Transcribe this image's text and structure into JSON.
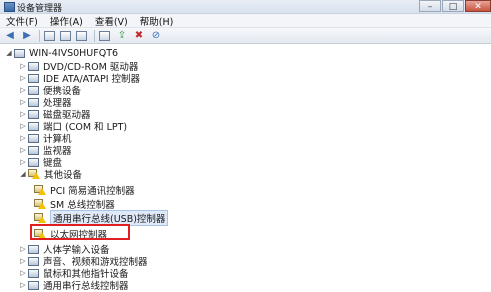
{
  "window": {
    "title": "设备管理器",
    "controls": [
      "–",
      "□",
      "✕"
    ]
  },
  "menu": [
    "文件(F)",
    "操作(A)",
    "查看(V)",
    "帮助(H)"
  ],
  "toolbar": {
    "buttons": [
      "back-icon",
      "forward-icon",
      "properties-icon",
      "help-icon",
      "scan-icon",
      "update-driver-icon",
      "disable-icon",
      "uninstall-icon"
    ]
  },
  "tree": {
    "root": "WIN-4IVS0HUFQT6",
    "items": [
      {
        "label": "DVD/CD-ROM 驱动器"
      },
      {
        "label": "IDE ATA/ATAPI 控制器"
      },
      {
        "label": "便携设备"
      },
      {
        "label": "处理器"
      },
      {
        "label": "磁盘驱动器"
      },
      {
        "label": "端口 (COM 和 LPT)"
      },
      {
        "label": "计算机"
      },
      {
        "label": "监视器"
      },
      {
        "label": "键盘"
      },
      {
        "label": "其他设备"
      },
      {
        "label": "PCI 简易通讯控制器"
      },
      {
        "label": "SM 总线控制器"
      },
      {
        "label": "通用串行总线(USB)控制器"
      },
      {
        "label": "以太网控制器"
      },
      {
        "label": "人体学输入设备"
      },
      {
        "label": "声音、视频和游戏控制器"
      },
      {
        "label": "鼠标和其他指针设备"
      },
      {
        "label": "通用串行总线控制器"
      }
    ]
  }
}
